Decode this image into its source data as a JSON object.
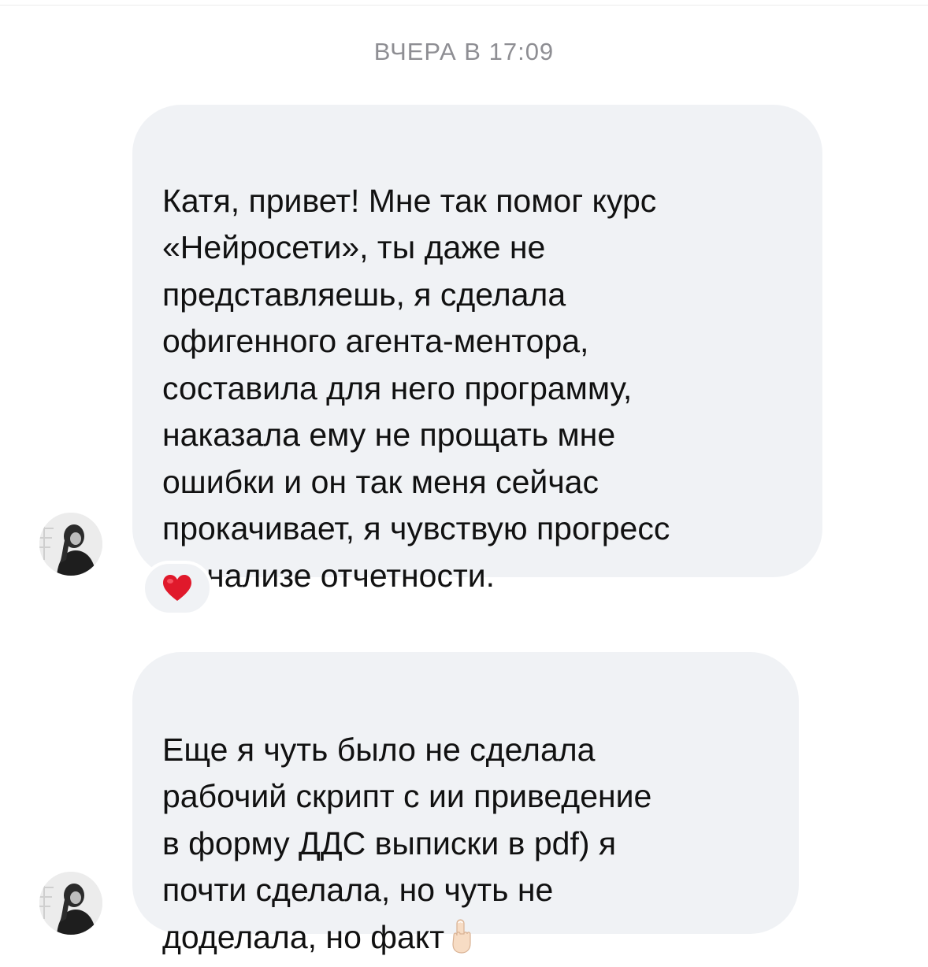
{
  "conversation": {
    "timestamp": "ВЧЕРА В 17:09",
    "messages": [
      {
        "text": "Катя, привет! Мне так помог курс\n«Нейросети», ты даже не\nпредставляешь, я сделала\nофигенного агента-ментора,\nсоставила для него программу,\nнаказала ему не прощать мне\nошибки и он так меня сейчас\nпрокачивает, я чувствую прогресс\nв анализе отчетности.",
        "reaction": "heart-emoji"
      },
      {
        "text": "Еще я чуть было не сделала\nрабочий скрипт с ии приведение\nв форму ДДС выписки в pdf) я\nпочти сделала, но чуть не\nдоделала, но факт",
        "trailing_emoji": "pointing-up-emoji"
      }
    ]
  },
  "colors": {
    "bubble_bg": "#f0f2f5",
    "timestamp": "#8e8e93",
    "text": "#111111",
    "heart": "#e0192b"
  }
}
